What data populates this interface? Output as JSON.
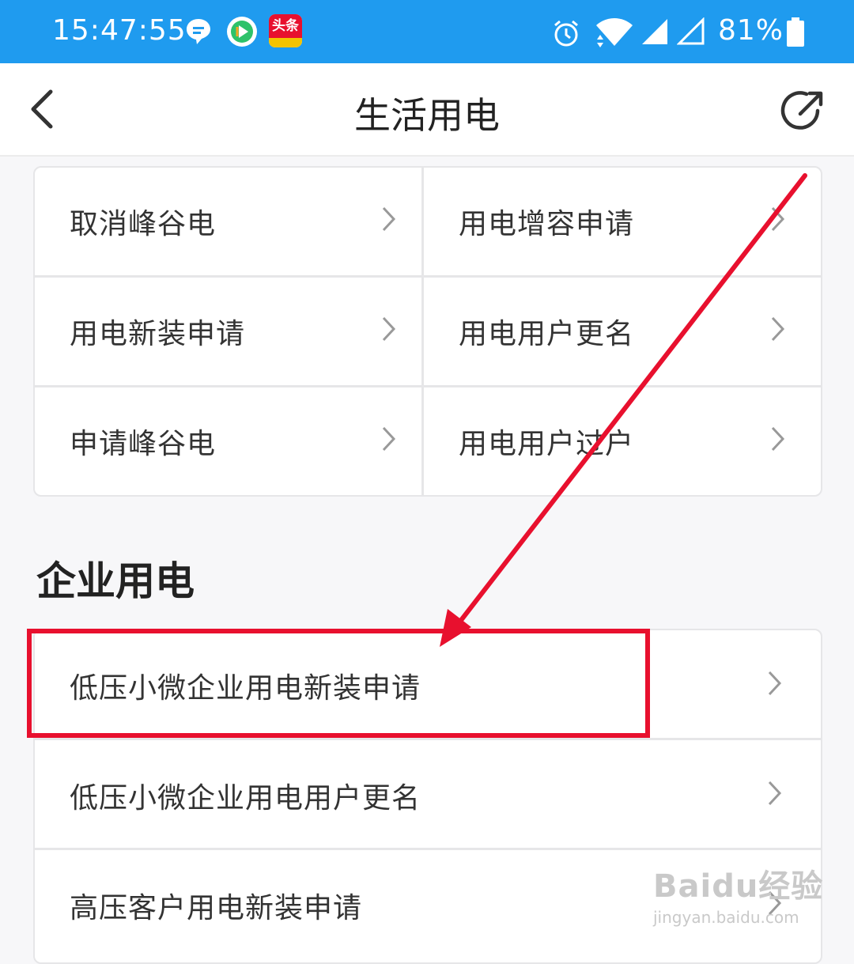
{
  "status_bar": {
    "time": "15:47:55",
    "battery": "81%",
    "app_badge": "头条",
    "icons": [
      "chat-bubble-icon",
      "video-play-icon",
      "toutiao-app-icon",
      "alarm-icon",
      "wifi-icon",
      "signal-icon",
      "signal-empty-icon",
      "battery-icon"
    ]
  },
  "header": {
    "title": "生活用电",
    "back_icon": "chevron-left-icon",
    "share_icon": "share-arrow-icon"
  },
  "grid": {
    "items": [
      {
        "label": "取消峰谷电"
      },
      {
        "label": "用电增容申请"
      },
      {
        "label": "用电新装申请"
      },
      {
        "label": "用电用户更名"
      },
      {
        "label": "申请峰谷电"
      },
      {
        "label": "用电用户过户"
      }
    ]
  },
  "enterprise": {
    "title": "企业用电",
    "items": [
      {
        "label": "低压小微企业用电新装申请"
      },
      {
        "label": "低压小微企业用电用户更名"
      },
      {
        "label": "高压客户用电新装申请"
      }
    ]
  },
  "annotation": {
    "color": "#e8102e"
  },
  "watermark": {
    "text": "Baidu经验",
    "url": "jingyan.baidu.com"
  },
  "colors": {
    "status_bar": "#1f9bef",
    "background": "#f7f7f9"
  }
}
